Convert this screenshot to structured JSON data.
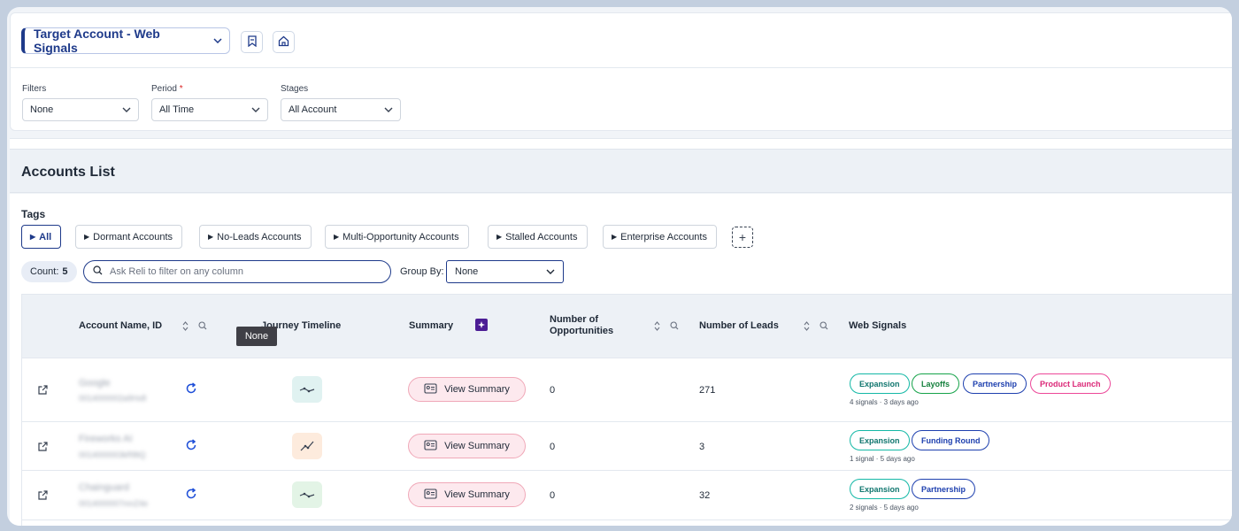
{
  "header": {
    "title": "Target Account - Web Signals"
  },
  "filters": {
    "filters_label": "Filters",
    "filters_value": "None",
    "period_label": "Period",
    "period_required": "*",
    "period_value": "All Time",
    "stages_label": "Stages",
    "stages_value": "All Account"
  },
  "accounts": {
    "title": "Accounts List",
    "tags_label": "Tags",
    "tags": [
      "All",
      "Dormant Accounts",
      "No-Leads Accounts",
      "Multi-Opportunity Accounts",
      "Stalled Accounts",
      "Enterprise Accounts"
    ],
    "add_tag": "+",
    "count_label": "Count:",
    "count_value": "5",
    "search_placeholder": "Ask Reli to filter on any column",
    "group_by_label": "Group By:",
    "group_by_value": "None",
    "tooltip": "None"
  },
  "table": {
    "columns": {
      "account": "Account Name, ID",
      "journey": "Journey Timeline",
      "summary": "Summary",
      "opportunities_line1": "Number of",
      "opportunities_line2": "Opportunities",
      "leads": "Number of Leads",
      "signals": "Web Signals"
    },
    "view_summary_label": "View Summary",
    "rows": [
      {
        "name": "Google",
        "id": "0014000002a9Hx8",
        "opportunities": "0",
        "leads": "271",
        "signals": [
          "Expansion",
          "Layoffs",
          "Partnership",
          "Product Launch"
        ],
        "signal_meta": "4 signals · 3 days ago"
      },
      {
        "name": "Fireworks AI",
        "id": "0014000003kR8tQ",
        "opportunities": "0",
        "leads": "3",
        "signals": [
          "Expansion",
          "Funding Round"
        ],
        "signal_meta": "1 signal · 5 days ago"
      },
      {
        "name": "Chainguard",
        "id": "0014000007mnZ4e",
        "opportunities": "0",
        "leads": "32",
        "signals": [
          "Expansion",
          "Partnership"
        ],
        "signal_meta": "2 signals · 5 days ago"
      }
    ]
  },
  "colors": {
    "accent": "#1e3a8a",
    "summary_pink": "#fde9ee",
    "teal_chip": "#14b8a6",
    "green_chip": "#16a34a",
    "pink_chip": "#ec4899"
  },
  "icons": {
    "bookmark": "bookmark-icon",
    "home": "home-icon",
    "external": "external-link-icon",
    "refresh": "refresh-icon",
    "search": "search-icon",
    "sort": "sort-icon",
    "journey": "journey-chart-icon",
    "summary_ai": "ai-sparkle-icon",
    "id_card": "id-card-icon"
  }
}
